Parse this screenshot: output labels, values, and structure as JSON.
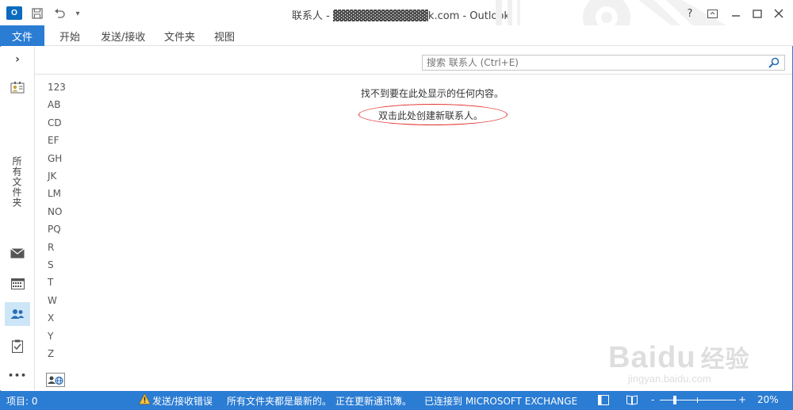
{
  "titlebar": {
    "app_icon": "O",
    "title": "联系人 - ▓▓▓▓▓▓▓▓▓▓▓▓k.com - Outlook",
    "help": "?",
    "icons": [
      "outlook-app-icon",
      "save-icon",
      "undo-icon",
      "customize-qat-icon",
      "help-icon",
      "ribbon-display-icon",
      "minimize-icon",
      "maximize-icon",
      "close-icon"
    ]
  },
  "ribbon": {
    "file": "文件",
    "tabs": [
      "开始",
      "发送/接收",
      "文件夹",
      "视图"
    ]
  },
  "leftnav": {
    "expand": "›",
    "folder_label": "所有文件夹",
    "more": "•••"
  },
  "search": {
    "placeholder": "搜索 联系人 (Ctrl+E)"
  },
  "index": [
    "123",
    "AB",
    "CD",
    "EF",
    "GH",
    "JK",
    "LM",
    "NO",
    "PQ",
    "R",
    "S",
    "T",
    "W",
    "X",
    "Y",
    "Z"
  ],
  "content": {
    "empty_message": "找不到要在此处显示的任何内容。",
    "create_message": "双击此处创建新联系人。"
  },
  "statusbar": {
    "items": "项目: 0",
    "error": "发送/接收错误",
    "folders_status": "所有文件夹都是最新的。",
    "updating": "正在更新通讯簿。",
    "connected": "已连接到 MICROSOFT EXCHANGE",
    "zoom_minus": "-",
    "zoom_plus": "+",
    "zoom": "20%",
    "zoom_fraction": 0.2
  },
  "watermark": {
    "brand": "Baidu",
    "cn": "经验",
    "url": "jingyan.baidu.com"
  },
  "colors": {
    "accent": "#2b7cd3",
    "circle": "#e0342f"
  }
}
